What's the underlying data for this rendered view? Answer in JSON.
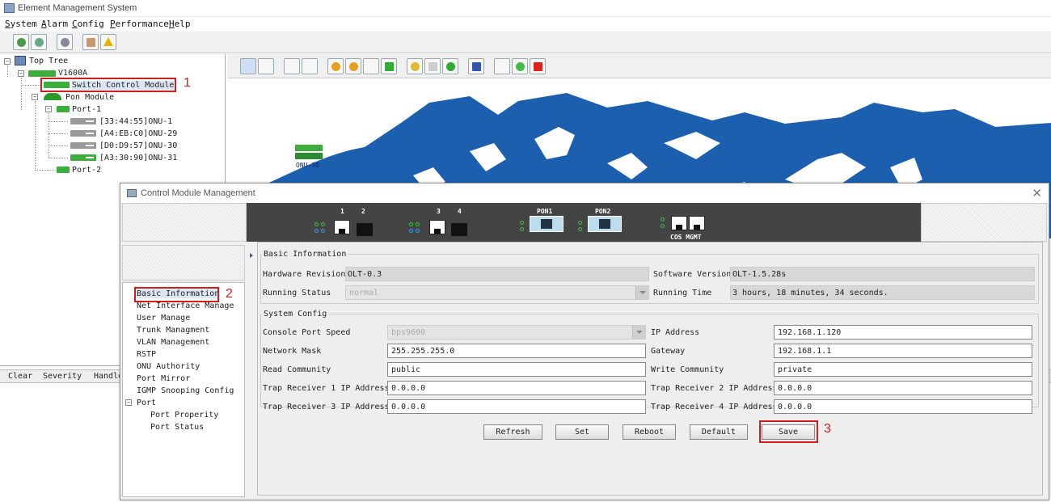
{
  "app": {
    "title": "Element Management System"
  },
  "menu": [
    {
      "label": "System",
      "ul": "S",
      "rest": "ystem"
    },
    {
      "label": "Alarm",
      "ul": "A",
      "rest": "larm"
    },
    {
      "label": "Config",
      "ul": "C",
      "rest": "onfig"
    },
    {
      "label": "Performance",
      "ul": "P",
      "rest": "erformance"
    },
    {
      "label": "Help",
      "ul": "H",
      "rest": "elp"
    }
  ],
  "tree": {
    "root": "Top Tree",
    "olt": "V1600A",
    "switch_module": "Switch Control Module",
    "pon_module": "Pon Module",
    "port1": "Port-1",
    "onus": [
      "[33:44:55]ONU-1",
      "[A4:EB:C0]ONU-29",
      "[D0:D9:57]ONU-30",
      "[A3:30:90]ONU-31"
    ],
    "port2": "Port-2"
  },
  "map": {
    "device_label": "ONU-30"
  },
  "alarm": {
    "headers": [
      "Clear",
      "Severity",
      "Handle"
    ]
  },
  "dialog": {
    "title": "Control Module Management",
    "panel": {
      "ports12": [
        "1",
        "2"
      ],
      "ports34": [
        "3",
        "4"
      ],
      "pon1": "PON1",
      "pon2": "PON2",
      "cos_mgmt": "COS MGMT"
    },
    "menu": {
      "items": [
        "Basic Information",
        "Net Interface Manage",
        "User Manage",
        "Trunk Managment",
        "VLAN Management",
        "RSTP",
        "ONU Authority",
        "Port Mirror",
        "IGMP Snooping Config"
      ],
      "port_group": "Port",
      "port_items": [
        "Port Properity",
        "Port Status"
      ]
    },
    "basic": {
      "title": "Basic Information",
      "hardware_revision_label": "Hardware Revision",
      "hardware_revision": "OLT-0.3",
      "software_version_label": "Software Version",
      "software_version": "OLT-1.5.28s",
      "running_status_label": "Running Status",
      "running_status": "normal",
      "running_time_label": "Running Time",
      "running_time": "3 hours, 18 minutes, 34 seconds."
    },
    "config": {
      "title": "System Config",
      "console_speed_label": "Console Port Speed",
      "console_speed": "bps9600",
      "ip_label": "IP Address",
      "ip": "192.168.1.120",
      "mask_label": "Network Mask",
      "mask": "255.255.255.0",
      "gateway_label": "Gateway",
      "gateway": "192.168.1.1",
      "read_label": "Read Community",
      "read": "public",
      "write_label": "Write Community",
      "write": "private",
      "trap1_label": "Trap Receiver 1 IP Address",
      "trap1": "0.0.0.0",
      "trap2_label": "Trap Receiver 2 IP Address",
      "trap2": "0.0.0.0",
      "trap3_label": "Trap Receiver 3 IP Address",
      "trap3": "0.0.0.0",
      "trap4_label": "Trap Receiver 4 IP Address",
      "trap4": "0.0.0.0"
    },
    "buttons": {
      "refresh": "Refresh",
      "set": "Set",
      "reboot": "Reboot",
      "default": "Default",
      "save": "Save"
    }
  },
  "annotations": {
    "one": "1",
    "two": "2",
    "three": "3"
  },
  "colors": {
    "highlight": "#d11d1d",
    "map_sea": "#1b5fae",
    "device_green": "#3cae3c"
  }
}
